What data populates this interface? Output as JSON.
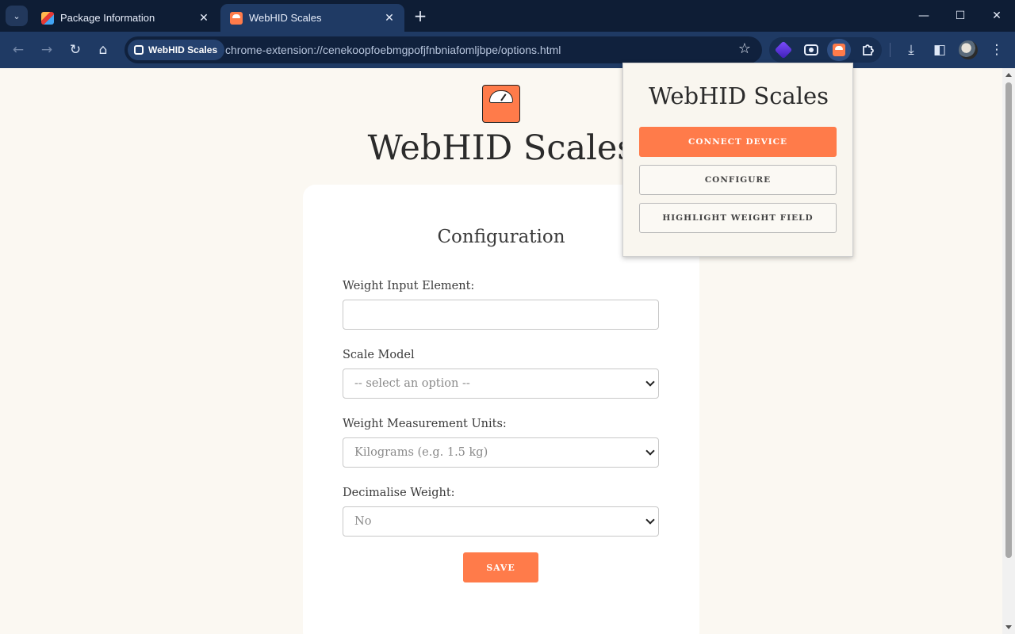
{
  "tabs": [
    {
      "title": "Package Information",
      "close": "✕"
    },
    {
      "title": "WebHID Scales",
      "close": "✕"
    }
  ],
  "tab_strip": {
    "search_glyph": "⌄",
    "new_tab": "+"
  },
  "window_controls": {
    "minimize": "—",
    "maximize": "☐",
    "close": "✕"
  },
  "toolbar": {
    "back": "←",
    "forward": "→",
    "reload": "↻",
    "home": "⌂",
    "site_chip": "WebHID Scales",
    "url": "chrome-extension://cenekoopfoebmgpofjfnbniafomljbpe/options.html",
    "bookmark": "☆",
    "download": "⤓",
    "side_panel": "◧",
    "menu": "⋮"
  },
  "page": {
    "title": "WebHID Scales",
    "card_title": "Configuration",
    "fields": {
      "weight_input_label": "Weight Input Element:",
      "weight_input_value": "",
      "scale_model_label": "Scale Model",
      "scale_model_value": "-- select an option --",
      "units_label": "Weight Measurement Units:",
      "units_value": "Kilograms (e.g. 1.5 kg)",
      "decimalise_label": "Decimalise Weight:",
      "decimalise_value": "No"
    },
    "save_label": "SAVE"
  },
  "popup": {
    "title": "WebHID Scales",
    "connect_label": "CONNECT DEVICE",
    "configure_label": "CONFIGURE",
    "highlight_label": "HIGHLIGHT WEIGHT FIELD"
  },
  "colors": {
    "accent": "#ff7b4a",
    "chrome_dark": "#0e1d35",
    "chrome_toolbar": "#1f3a64",
    "page_bg": "#fbf8f2"
  }
}
